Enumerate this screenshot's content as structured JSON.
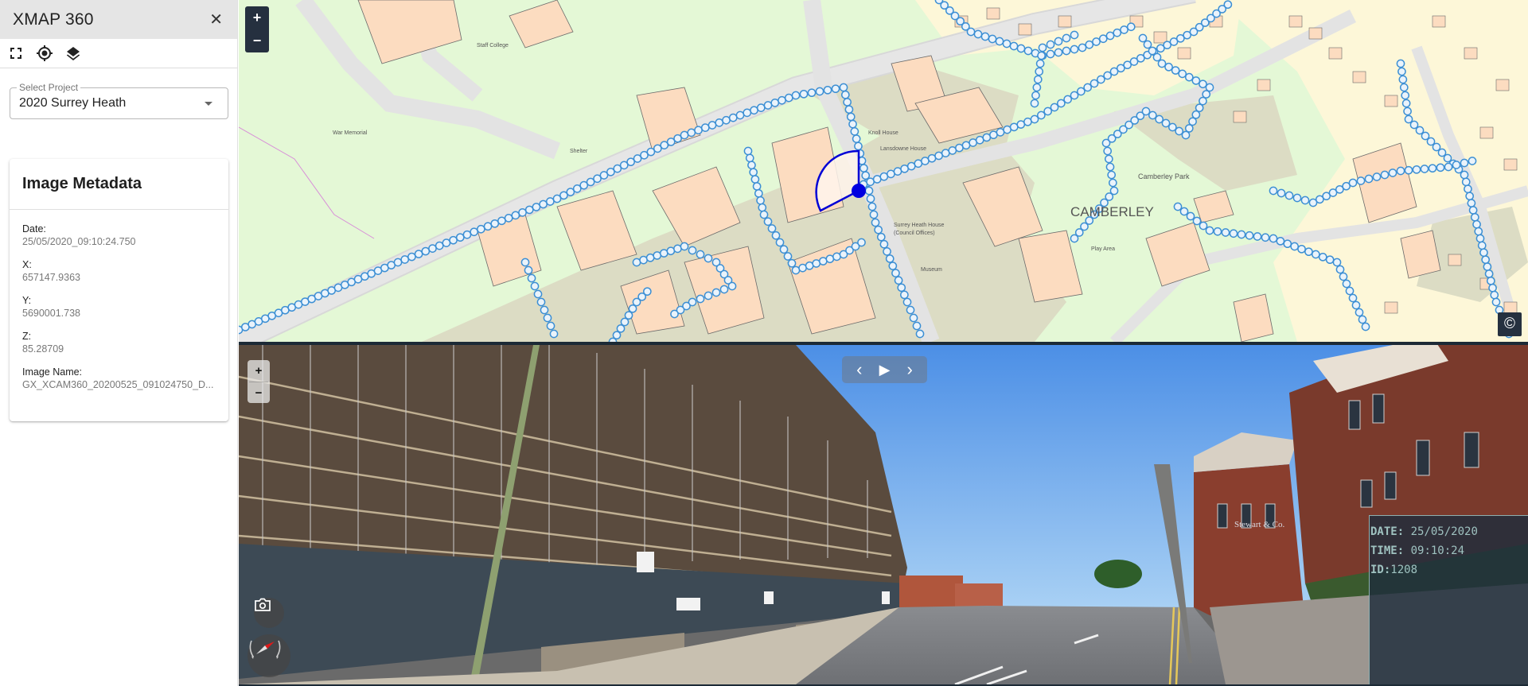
{
  "app": {
    "title": "XMAP 360",
    "close_icon": "close-icon"
  },
  "toolbar": {
    "items": [
      {
        "icon": "fullscreen-icon",
        "label": "Fullscreen"
      },
      {
        "icon": "locate-icon",
        "label": "Locate"
      },
      {
        "icon": "layers-icon",
        "label": "Layers"
      }
    ]
  },
  "project_select": {
    "label": "Select Project",
    "value": "2020 Surrey Heath"
  },
  "metadata": {
    "title": "Image Metadata",
    "fields": [
      {
        "label": "Date:",
        "value": "25/05/2020_09:10:24.750"
      },
      {
        "label": "X:",
        "value": "657147.9363"
      },
      {
        "label": "Y:",
        "value": "5690001.738"
      },
      {
        "label": "Z:",
        "value": "85.28709"
      },
      {
        "label": "Image Name:",
        "value": "GX_XCAM360_20200525_091024750_D..."
      }
    ]
  },
  "map": {
    "zoom_in": "+",
    "zoom_out": "−",
    "copyright": "©",
    "labels": {
      "town": "CAMBERLEY",
      "park": "Camberley Park",
      "staff_college": "Staff College",
      "war_memorial": "War Memorial",
      "shelter": "Shelter",
      "play_area": "Play Area",
      "surrey_heath_house": "Surrey Heath House",
      "council_offices": "(Council Offices)",
      "museum": "Museum",
      "knoll_house": "Knoll House",
      "lansdowne_house": "Lansdowne House"
    },
    "colors": {
      "grass": "#e4f8d6",
      "road": "#e0e0e0",
      "building": "#fcdcc0",
      "paved": "#dcdcc4",
      "residential": "#fdf7d8",
      "trackpoint": "#3c8fd4",
      "view_cone": "#0000d6"
    }
  },
  "panorama": {
    "zoom_in": "+",
    "zoom_out": "−",
    "nav": {
      "prev": "‹",
      "play": "▶",
      "next": "›"
    },
    "camera_icon": "camera-icon",
    "compass_icon": "compass-icon",
    "sign_text": "Stewart & Co.",
    "info": [
      {
        "key": "DATE:",
        "value": " 25/05/2020"
      },
      {
        "key": "TIME:",
        "value": " 09:10:24"
      },
      {
        "key": "ID:",
        "value": "1208"
      }
    ]
  }
}
